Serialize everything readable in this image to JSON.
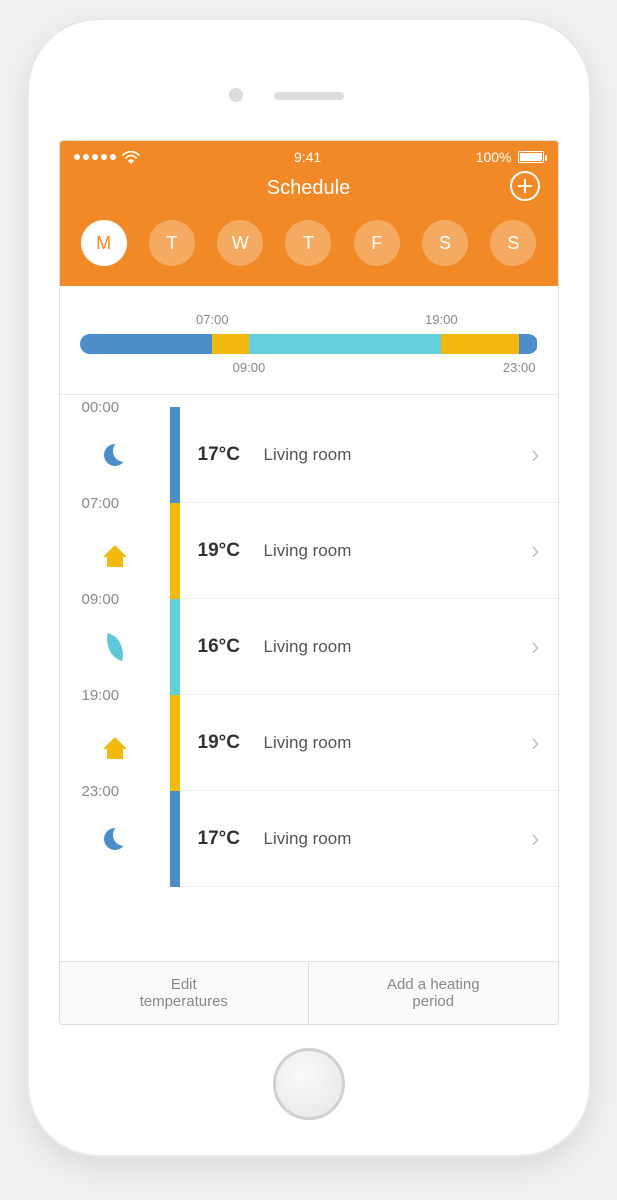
{
  "status": {
    "time": "9:41",
    "battery": "100%"
  },
  "header": {
    "title": "Schedule"
  },
  "days": [
    {
      "label": "M",
      "selected": true
    },
    {
      "label": "T",
      "selected": false
    },
    {
      "label": "W",
      "selected": false
    },
    {
      "label": "T",
      "selected": false
    },
    {
      "label": "F",
      "selected": false
    },
    {
      "label": "S",
      "selected": false
    },
    {
      "label": "S",
      "selected": false
    }
  ],
  "timeline": {
    "top_labels": [
      {
        "t": "07:00",
        "pct": 29
      },
      {
        "t": "19:00",
        "pct": 79
      }
    ],
    "bottom_labels": [
      {
        "t": "09:00",
        "pct": 37
      },
      {
        "t": "23:00",
        "pct": 96
      }
    ],
    "segments": [
      {
        "width": 29,
        "color": "#4d8ec9"
      },
      {
        "width": 8,
        "color": "#f2b90f"
      },
      {
        "width": 42,
        "color": "#63d0db"
      },
      {
        "width": 17,
        "color": "#f2b90f"
      },
      {
        "width": 4,
        "color": "#4d8ec9"
      }
    ]
  },
  "periods": [
    {
      "start": "00:00",
      "icon": "moon",
      "color": "#4d8ec9",
      "temp": "17°C",
      "room": "Living room"
    },
    {
      "start": "07:00",
      "icon": "house",
      "color": "#f2b90f",
      "temp": "19°C",
      "room": "Living room"
    },
    {
      "start": "09:00",
      "icon": "leaf",
      "color": "#63d0db",
      "temp": "16°C",
      "room": "Living room"
    },
    {
      "start": "19:00",
      "icon": "house",
      "color": "#f2b90f",
      "temp": "19°C",
      "room": "Living room"
    },
    {
      "start": "23:00",
      "icon": "moon",
      "color": "#4d8ec9",
      "temp": "17°C",
      "room": "Living room"
    }
  ],
  "footer": {
    "edit": "Edit\ntemperatures",
    "add": "Add a heating\nperiod"
  },
  "colors": {
    "accent": "#f18a26",
    "night": "#4d8ec9",
    "home": "#f2b90f",
    "eco": "#63d0db"
  }
}
